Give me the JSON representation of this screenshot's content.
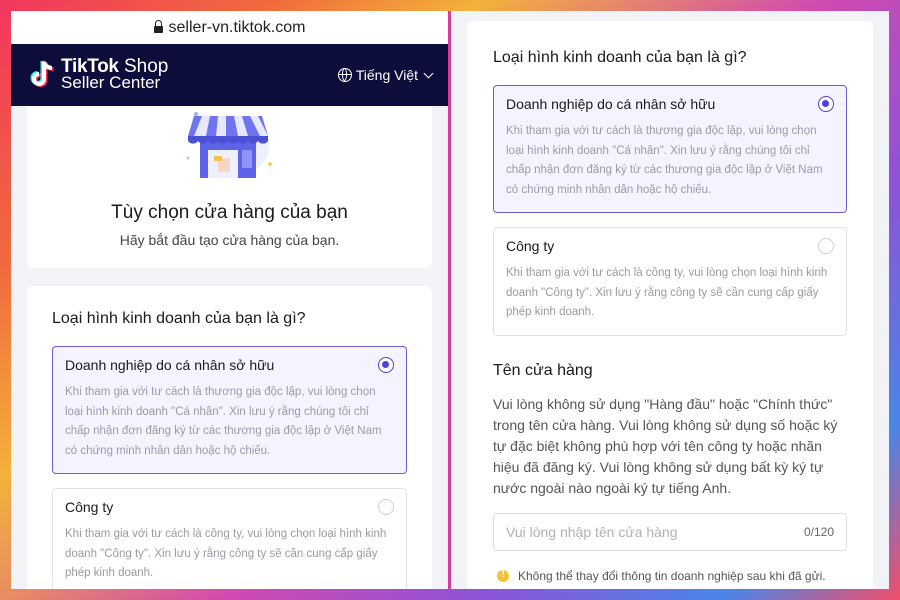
{
  "browser": {
    "url": "seller-vn.tiktok.com"
  },
  "header": {
    "brand_main": "TikTok",
    "brand_shop": "Shop",
    "brand_sub": "Seller Center",
    "language": "Tiếng Việt"
  },
  "hero": {
    "title": "Tùy chọn cửa hàng của bạn",
    "subtitle": "Hãy bắt đầu tạo cửa hàng của bạn."
  },
  "business": {
    "question": "Loại hình kinh doanh của bạn là gì?",
    "options": [
      {
        "title": "Doanh nghiệp do cá nhân sở hữu",
        "description": "Khi tham gia với tư cách là thương gia độc lập, vui lòng chọn loại hình kinh doanh \"Cá nhân\". Xin lưu ý rằng chúng tôi chỉ chấp nhận đơn đăng ký từ các thương gia độc lập ở Việt Nam có chứng minh nhân dân hoặc hộ chiếu.",
        "selected": true
      },
      {
        "title": "Công ty",
        "description": "Khi tham gia với tư cách là công ty, vui lòng chọn loại hình kinh doanh \"Công ty\". Xin lưu ý rằng công ty sẽ cần cung cấp giấy phép kinh doanh.",
        "selected": false
      }
    ]
  },
  "store_name": {
    "title": "Tên cửa hàng",
    "description": "Vui lòng không sử dụng \"Hàng đầu\" hoặc \"Chính thức\" trong tên cửa hàng. Vui lòng không sử dụng số hoặc ký tự đặc biệt không phù hợp với tên công ty hoặc nhãn hiệu đã đăng ký. Vui lòng không sử dụng bất kỳ ký tự nước ngoài nào ngoài ký tự tiếng Anh.",
    "placeholder": "Vui lòng nhập tên cửa hàng",
    "value": "",
    "counter": "0/120"
  },
  "notice": "Không thể thay đổi thông tin doanh nghiệp sau khi đã gửi.",
  "colors": {
    "header_bg": "#0d0d3b",
    "accent": "#4b3fe0",
    "selected_bg": "#f5f3ff",
    "warning": "#f6c232"
  },
  "icons": [
    "lock-icon",
    "tiktok-logo-icon",
    "globe-icon",
    "chevron-down-icon",
    "store-illustration-icon",
    "radio-selected-icon",
    "radio-unselected-icon",
    "warning-icon"
  ]
}
